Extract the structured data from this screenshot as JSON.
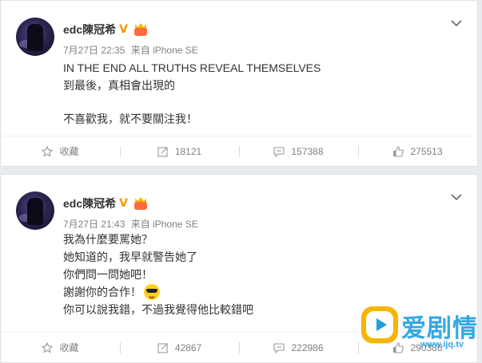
{
  "posts": [
    {
      "username": "edc陳冠希",
      "verified_badge": "V",
      "date": "7月27日 22:35",
      "source": "来自 iPhone SE",
      "lines": [
        "IN THE END ALL TRUTHS REVEAL THEMSELVES",
        "到最後，真相會出現的",
        "",
        "不喜歡我，就不要關注我！"
      ],
      "actions": {
        "favorite": "收藏",
        "repost": "18121",
        "comment": "157388",
        "like": "275513"
      }
    },
    {
      "username": "edc陳冠希",
      "verified_badge": "V",
      "date": "7月27日 21:43",
      "source": "来自 iPhone SE",
      "lines": [
        "我為什麼要罵她？",
        "她知道的，我早就警告她了",
        "你們問一問她吧！",
        "謝謝你的合作！",
        "你可以說我錯，不過我覺得他比較錯吧"
      ],
      "actions": {
        "favorite": "收藏",
        "repost": "42867",
        "comment": "222986",
        "like": "290386"
      }
    }
  ],
  "watermark": {
    "brand": "爱剧情",
    "url": "www.ijq.tv"
  },
  "colors": {
    "page_bg": "#e9ecef",
    "text": "#333333",
    "muted": "#808080",
    "verified": "#f39700",
    "watermark_blue": "#33a8e6",
    "watermark_orange": "#f7b500"
  },
  "icons": [
    "chevron-down-icon",
    "star-icon",
    "repost-icon",
    "comment-icon",
    "thumbs-up-icon",
    "sunglasses-emoji",
    "member-crown-icon"
  ]
}
